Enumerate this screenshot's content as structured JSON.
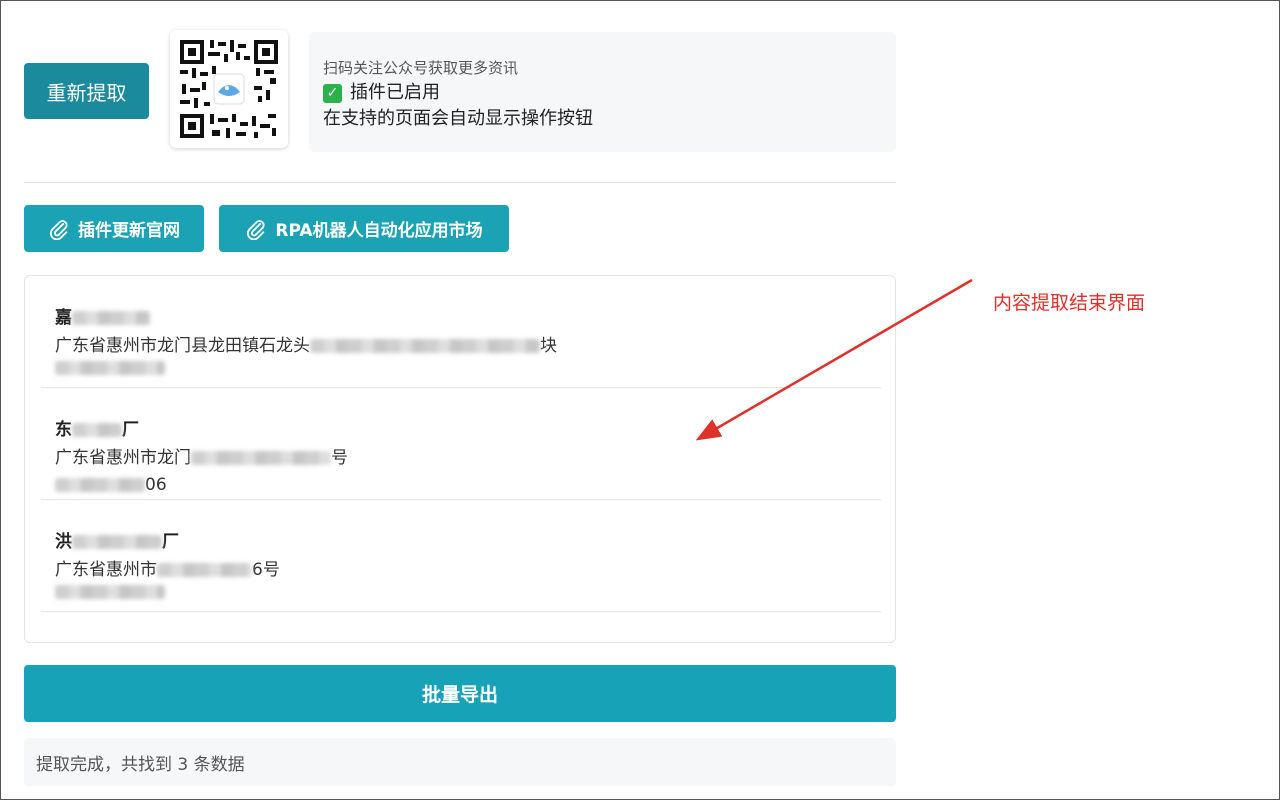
{
  "toolbar": {
    "reextract_label": "重新提取"
  },
  "info": {
    "scan_tip": "扫码关注公众号获取更多资讯",
    "enabled_text": "插件已启用",
    "auto_text": "在支持的页面会自动显示操作按钮"
  },
  "links": {
    "update_site_label": "插件更新官网",
    "rpa_market_label": "RPA机器人自动化应用市场"
  },
  "results": [
    {
      "name_visible": "嘉",
      "name_suffix": "",
      "addr_prefix": "广东省惠州市龙门县龙田镇石龙头",
      "addr_suffix": "块",
      "phone_visible": ""
    },
    {
      "name_visible": "东",
      "name_suffix": "厂",
      "addr_prefix": "广东省惠州市龙门",
      "addr_suffix": "号",
      "phone_visible": "06"
    },
    {
      "name_visible": "洪",
      "name_suffix": "厂",
      "addr_prefix": "广东省惠州市",
      "addr_suffix": "6号",
      "phone_visible": ""
    }
  ],
  "export": {
    "label": "批量导出"
  },
  "status": {
    "text": "提取完成，共找到 3 条数据"
  },
  "annotation": {
    "text": "内容提取结束界面",
    "color": "#e0302a"
  },
  "colors": {
    "primary_dark": "#1a8a9c",
    "primary": "#17a2b8",
    "success": "#2bb24c"
  }
}
